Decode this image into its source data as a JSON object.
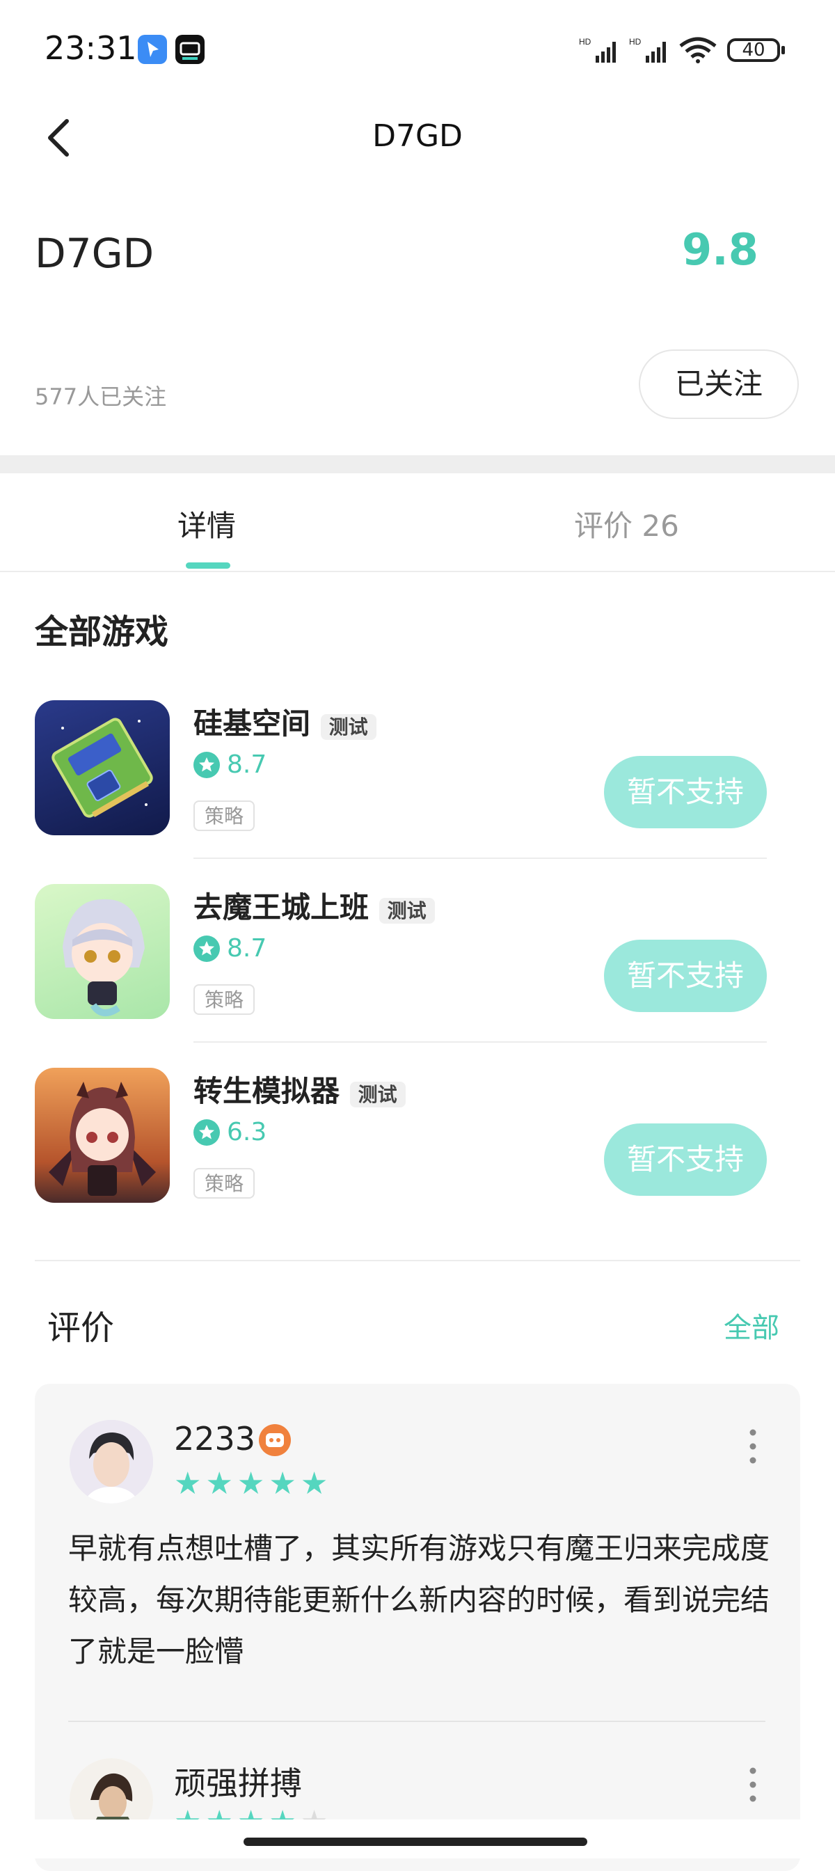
{
  "status_bar": {
    "time": "23:31",
    "app_icons": [
      "navigation-app-icon",
      "tv-app-icon"
    ],
    "signal_label_1": "HD",
    "signal_label_2": "HD",
    "battery": "40"
  },
  "header": {
    "title": "D7GD"
  },
  "developer": {
    "name": "D7GD",
    "score": "9.8",
    "followers": "577人已关注",
    "follow_button": "已关注"
  },
  "tabs": [
    {
      "label": "详情",
      "active": true
    },
    {
      "label": "评价 26",
      "active": false
    }
  ],
  "games_section": {
    "title": "全部游戏",
    "games": [
      {
        "name": "硅基空间",
        "tag": "测试",
        "rating": "8.7",
        "genre": "策略",
        "button": "暂不支持"
      },
      {
        "name": "去魔王城上班",
        "tag": "测试",
        "rating": "8.7",
        "genre": "策略",
        "button": "暂不支持"
      },
      {
        "name": "转生模拟器",
        "tag": "测试",
        "rating": "6.3",
        "genre": "策略",
        "button": "暂不支持"
      }
    ]
  },
  "reviews_section": {
    "title": "评价",
    "all_link": "全部",
    "reviews": [
      {
        "user": "2233",
        "stars": 5,
        "text": "早就有点想吐槽了，其实所有游戏只有魔王归来完成度较高，每次期待能更新什么新内容的时候，看到说完结了就是一脸懵"
      },
      {
        "user": "顽强拼搏",
        "stars": 4
      }
    ]
  },
  "colors": {
    "accent": "#47c9b1",
    "button_disabled": "#9be8dc",
    "star": "#55d6bf"
  }
}
